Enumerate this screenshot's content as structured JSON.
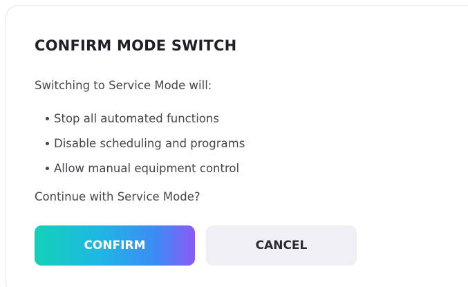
{
  "dialog": {
    "title": "CONFIRM MODE SWITCH",
    "intro": "Switching to Service Mode will:",
    "bullets": [
      "Stop all automated functions",
      "Disable scheduling and programs",
      "Allow manual equipment control"
    ],
    "question": "Continue with Service Mode?",
    "confirm_label": "CONFIRM",
    "cancel_label": "CANCEL"
  },
  "colors": {
    "confirm_gradient": [
      "#14d1b8",
      "#1eb7e3",
      "#3d8bf5",
      "#8a5af6"
    ],
    "cancel_background": "#f0f0f4",
    "text": "#45454f",
    "title": "#1f1f28"
  }
}
